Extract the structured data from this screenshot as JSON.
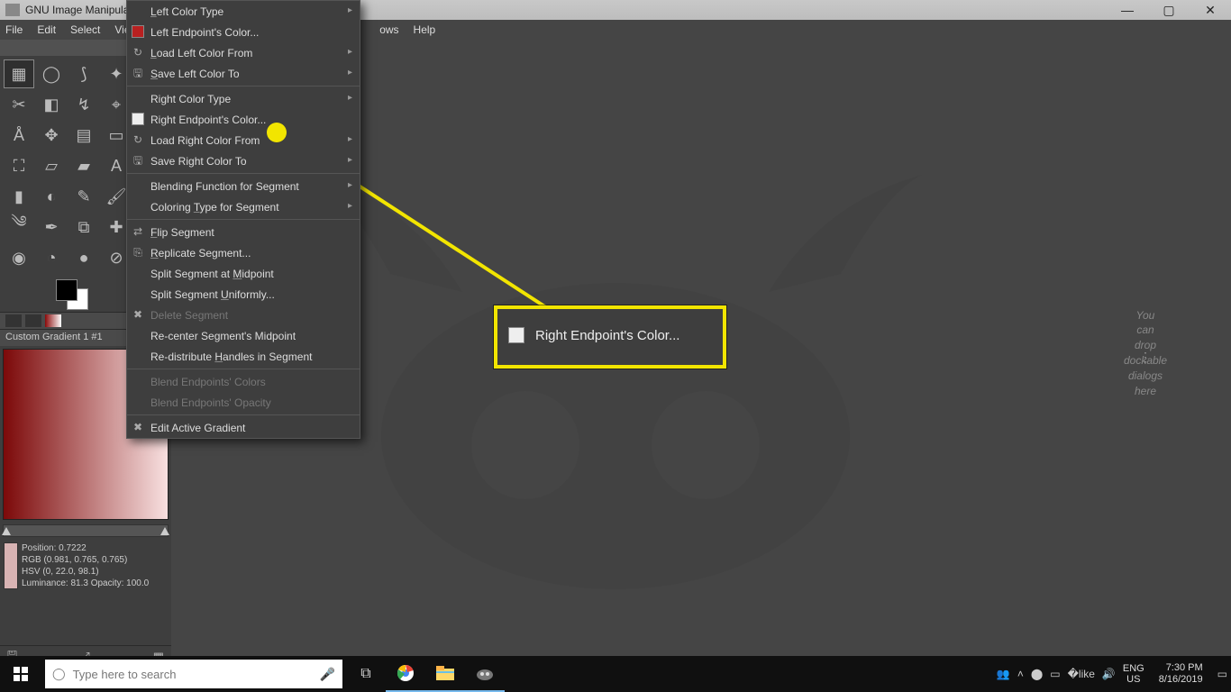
{
  "titlebar": {
    "app_name": "GNU Image Manipula"
  },
  "menubar": {
    "file": "File",
    "edit": "Edit",
    "select": "Select",
    "view": "View",
    "windows": "ows",
    "help": "Help"
  },
  "context_menu": {
    "left_color_type": "Left Color Type",
    "left_endpoint_color": "Left Endpoint's Color...",
    "load_left": "Load Left Color From",
    "save_left": "Save Left Color To",
    "right_color_type": "Right Color Type",
    "right_endpoint_color": "Right Endpoint's Color...",
    "load_right": "Load Right Color From",
    "save_right": "Save Right Color To",
    "blending_fn": "Blending Function for Segment",
    "coloring_type": "Coloring Type for Segment",
    "flip_segment": "Flip Segment",
    "replicate_segment": "Replicate Segment...",
    "split_midpoint": "Split Segment at Midpoint",
    "split_uniform": "Split Segment Uniformly...",
    "delete_segment": "Delete Segment",
    "recenter": "Re-center Segment's Midpoint",
    "redistribute": "Re-distribute Handles in Segment",
    "blend_colors": "Blend Endpoints' Colors",
    "blend_opacity": "Blend Endpoints' Opacity",
    "edit_active": "Edit Active Gradient"
  },
  "callout": {
    "label": "Right Endpoint's Color..."
  },
  "gradient": {
    "title": "Custom Gradient 1 #1",
    "position": "Position: 0.7222",
    "rgb": "RGB (0.981, 0.765, 0.765)",
    "hsv": "HSV (0, 22.0, 98.1)",
    "lum_opacity": "Luminance: 81.3    Opacity: 100.0"
  },
  "right_hint": {
    "l1": "You",
    "l2": "can",
    "l3": "drop",
    "l4": "dockable",
    "l5": "dialogs",
    "l6": "here"
  },
  "toolbox": {
    "names": [
      "rect-select",
      "ellipse-select",
      "free-select",
      "fuzzy-select",
      "by-color-select",
      "scissors",
      "foreground-select",
      "paths",
      "color-picker",
      "zoom",
      "measure",
      "move",
      "align",
      "crop",
      "rotate",
      "scale",
      "shear",
      "perspective",
      "flip",
      "transform",
      "cage",
      "warp",
      "text",
      "bucket-fill",
      "blend",
      "pencil",
      "paintbrush",
      "eraser",
      "airbrush",
      "ink",
      "clone",
      "heal",
      "perspective-clone",
      "blur",
      "color-tool",
      "smudge",
      "dodge"
    ]
  },
  "taskbar": {
    "search_placeholder": "Type here to search",
    "lang": "ENG",
    "locale": "US",
    "time": "7:30 PM",
    "date": "8/16/2019"
  }
}
